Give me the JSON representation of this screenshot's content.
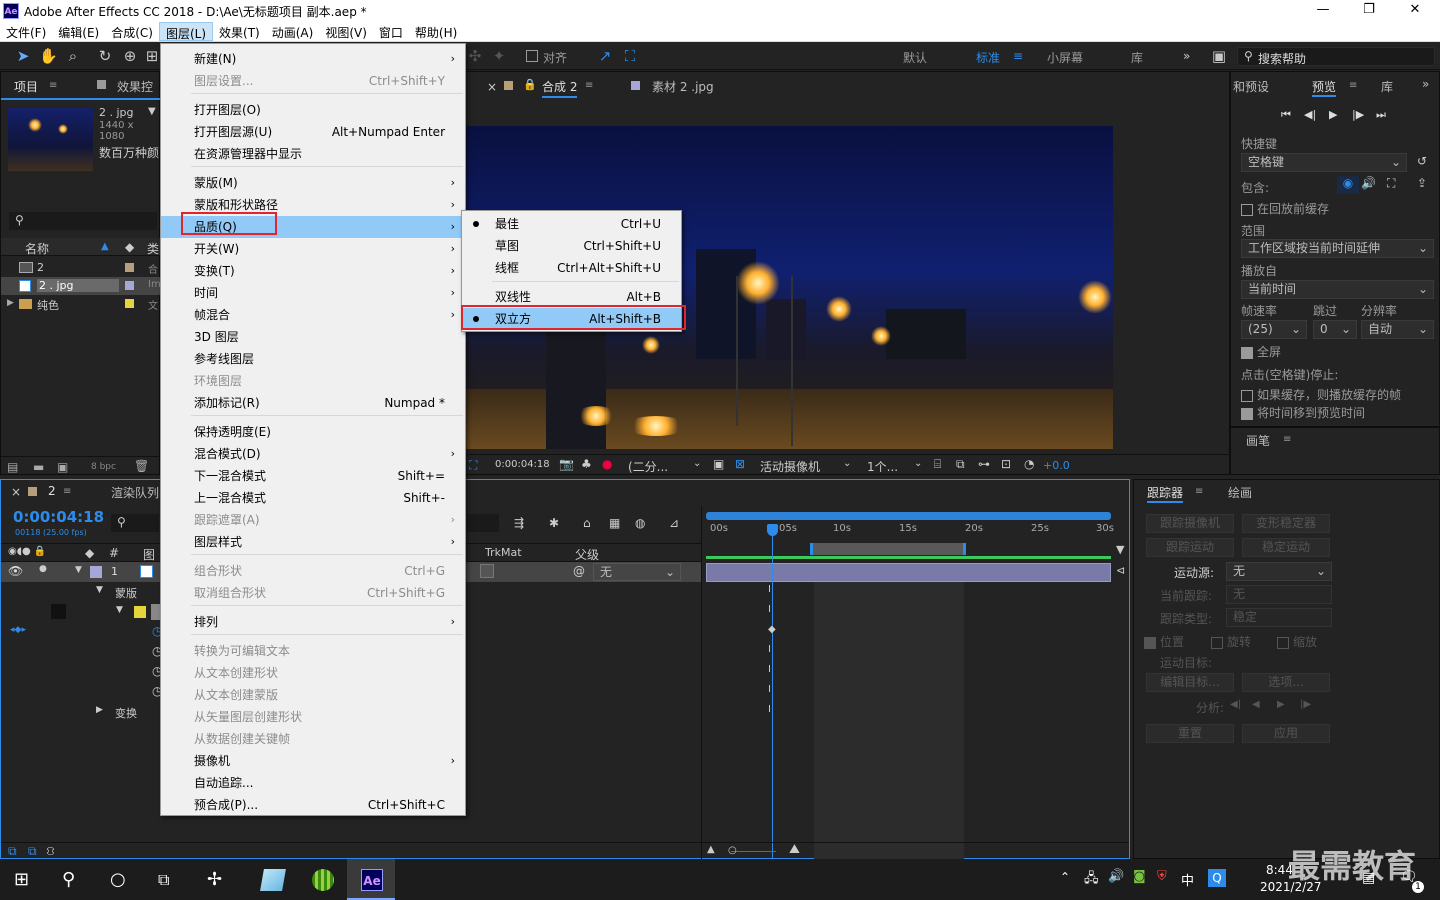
{
  "window": {
    "title": "Adobe After Effects CC 2018 - D:\\Ae\\无标题项目 副本.aep *",
    "logo": "Ae",
    "controls": [
      "—",
      "❐",
      "✕"
    ]
  },
  "menubar": [
    "文件(F)",
    "编辑(E)",
    "合成(C)",
    "图层(L)",
    "效果(T)",
    "动画(A)",
    "视图(V)",
    "窗口",
    "帮助(H)"
  ],
  "toolbar": {
    "snap_label": "对齐",
    "workspaces": [
      "默认",
      "标准",
      "小屏幕",
      "库"
    ],
    "search_placeholder": "搜索帮助"
  },
  "project": {
    "tab_label": "项目",
    "effects_tab": "效果控",
    "file_name": "2 . jpg",
    "file_info": "1440 x 1080",
    "file_desc": "数百万种颜",
    "col_name": "名称",
    "col_type": "类",
    "items": [
      {
        "name": "2",
        "type": "合"
      },
      {
        "name": "2 . jpg",
        "type": "Im"
      },
      {
        "name": "纯色",
        "type": "文"
      }
    ],
    "bpc": "8 bpc"
  },
  "comp": {
    "tabs": [
      "合成 2",
      "素材 2 .jpg"
    ],
    "timecode": "0:00:04:18",
    "resolution": "(二分...",
    "camera": "活动摄像机",
    "views": "1个...",
    "exposure": "+0.0"
  },
  "context_menu": {
    "items": [
      {
        "label": "新建(N)",
        "shortcut": "",
        "arrow": "›",
        "disabled": false
      },
      {
        "label": "图层设置...",
        "shortcut": "Ctrl+Shift+Y",
        "arrow": "",
        "disabled": true
      },
      {
        "label": "打开图层(O)",
        "shortcut": "",
        "arrow": "",
        "disabled": false
      },
      {
        "label": "打开图层源(U)",
        "shortcut": "Alt+Numpad Enter",
        "arrow": "",
        "disabled": false
      },
      {
        "label": "在资源管理器中显示",
        "shortcut": "",
        "arrow": "",
        "disabled": false
      },
      {
        "label": "蒙版(M)",
        "shortcut": "",
        "arrow": "›",
        "disabled": false
      },
      {
        "label": "蒙版和形状路径",
        "shortcut": "",
        "arrow": "›",
        "disabled": false
      },
      {
        "label": "品质(Q)",
        "shortcut": "",
        "arrow": "›",
        "disabled": false
      },
      {
        "label": "开关(W)",
        "shortcut": "",
        "arrow": "›",
        "disabled": false
      },
      {
        "label": "变换(T)",
        "shortcut": "",
        "arrow": "›",
        "disabled": false
      },
      {
        "label": "时间",
        "shortcut": "",
        "arrow": "›",
        "disabled": false
      },
      {
        "label": "帧混合",
        "shortcut": "",
        "arrow": "›",
        "disabled": false
      },
      {
        "label": "3D 图层",
        "shortcut": "",
        "arrow": "",
        "disabled": false
      },
      {
        "label": "参考线图层",
        "shortcut": "",
        "arrow": "",
        "disabled": false
      },
      {
        "label": "环境图层",
        "shortcut": "",
        "arrow": "",
        "disabled": true
      },
      {
        "label": "添加标记(R)",
        "shortcut": "Numpad *",
        "arrow": "",
        "disabled": false
      },
      {
        "label": "保持透明度(E)",
        "shortcut": "",
        "arrow": "",
        "disabled": false
      },
      {
        "label": "混合模式(D)",
        "shortcut": "",
        "arrow": "›",
        "disabled": false
      },
      {
        "label": "下一混合模式",
        "shortcut": "Shift+=",
        "arrow": "",
        "disabled": false
      },
      {
        "label": "上一混合模式",
        "shortcut": "Shift+-",
        "arrow": "",
        "disabled": false
      },
      {
        "label": "跟踪遮罩(A)",
        "shortcut": "",
        "arrow": "›",
        "disabled": true
      },
      {
        "label": "图层样式",
        "shortcut": "",
        "arrow": "›",
        "disabled": false
      },
      {
        "label": "组合形状",
        "shortcut": "Ctrl+G",
        "arrow": "",
        "disabled": true
      },
      {
        "label": "取消组合形状",
        "shortcut": "Ctrl+Shift+G",
        "arrow": "",
        "disabled": true
      },
      {
        "label": "排列",
        "shortcut": "",
        "arrow": "›",
        "disabled": false
      },
      {
        "label": "转换为可编辑文本",
        "shortcut": "",
        "arrow": "",
        "disabled": true
      },
      {
        "label": "从文本创建形状",
        "shortcut": "",
        "arrow": "",
        "disabled": true
      },
      {
        "label": "从文本创建蒙版",
        "shortcut": "",
        "arrow": "",
        "disabled": true
      },
      {
        "label": "从矢量图层创建形状",
        "shortcut": "",
        "arrow": "",
        "disabled": true
      },
      {
        "label": "从数据创建关键帧",
        "shortcut": "",
        "arrow": "",
        "disabled": true
      },
      {
        "label": "摄像机",
        "shortcut": "",
        "arrow": "›",
        "disabled": false
      },
      {
        "label": "自动追踪...",
        "shortcut": "",
        "arrow": "",
        "disabled": false
      },
      {
        "label": "预合成(P)...",
        "shortcut": "Ctrl+Shift+C",
        "arrow": "",
        "disabled": false
      }
    ]
  },
  "quality_submenu": {
    "items": [
      {
        "label": "最佳",
        "shortcut": "Ctrl+U",
        "checked": true
      },
      {
        "label": "草图",
        "shortcut": "Ctrl+Shift+U",
        "checked": false
      },
      {
        "label": "线框",
        "shortcut": "Ctrl+Alt+Shift+U",
        "checked": false
      },
      {
        "label": "双线性",
        "shortcut": "Alt+B",
        "checked": false
      },
      {
        "label": "双立方",
        "shortcut": "Alt+Shift+B",
        "checked": true
      }
    ]
  },
  "preview": {
    "tabs": [
      "和预设",
      "预览",
      "库"
    ],
    "shortcut_label": "快捷键",
    "shortcut_value": "空格键",
    "include_label": "包含:",
    "cache_before": "在回放前缓存",
    "range_label": "范围",
    "range_value": "工作区域按当前时间延伸",
    "play_from_label": "播放自",
    "play_from_value": "当前时间",
    "fps_label": "帧速率",
    "skip_label": "跳过",
    "res_label": "分辨率",
    "fps_value": "(25)",
    "skip_value": "0",
    "res_value": "自动",
    "fullscreen": "全屏",
    "stop_label": "点击(空格键)停止:",
    "opt1": "如果缓存，则播放缓存的帧",
    "opt2": "将时间移到预览时间",
    "brush_tab": "画笔"
  },
  "timeline": {
    "comp_tab": "2",
    "render_tab": "渲染队列",
    "timecode": "0:00:04:18",
    "frames": "00118 (25.00 fps)",
    "col_num": "#",
    "col_name": "图",
    "col_trkmat": "TrkMat",
    "col_parent": "父级",
    "parent_value": "无",
    "layer_num": "1",
    "mask_label": "蒙版",
    "transform_label": "变换",
    "ruler": [
      "00s",
      "05s",
      "10s",
      "15s",
      "20s",
      "25s",
      "30s"
    ]
  },
  "tracker": {
    "tabs": [
      "跟踪器",
      "绘画"
    ],
    "btn_track_camera": "跟踪摄像机",
    "btn_warp": "变形稳定器",
    "btn_track_motion": "跟踪运动",
    "btn_stabilize": "稳定运动",
    "motion_source_label": "运动源:",
    "motion_source_value": "无",
    "current_track_label": "当前跟踪:",
    "current_track_value": "无",
    "track_type_label": "跟踪类型:",
    "track_type_value": "稳定",
    "cb_position": "位置",
    "cb_rotation": "旋转",
    "cb_scale": "缩放",
    "motion_target_label": "运动目标:",
    "btn_edit_target": "编辑目标...",
    "btn_options": "选项...",
    "analyze_label": "分析:",
    "btn_reset": "重置",
    "btn_apply": "应用"
  },
  "taskbar": {
    "ime": "中",
    "time": "8:44",
    "date": "2021/2/27",
    "watermark": "最需教育",
    "badge": "1"
  },
  "colors": {
    "menu_highlight": "#91c9f7",
    "red_box": "#e0262c",
    "ae_blue": "#2d8ceb",
    "timecode_blue": "#2d8ceb"
  }
}
